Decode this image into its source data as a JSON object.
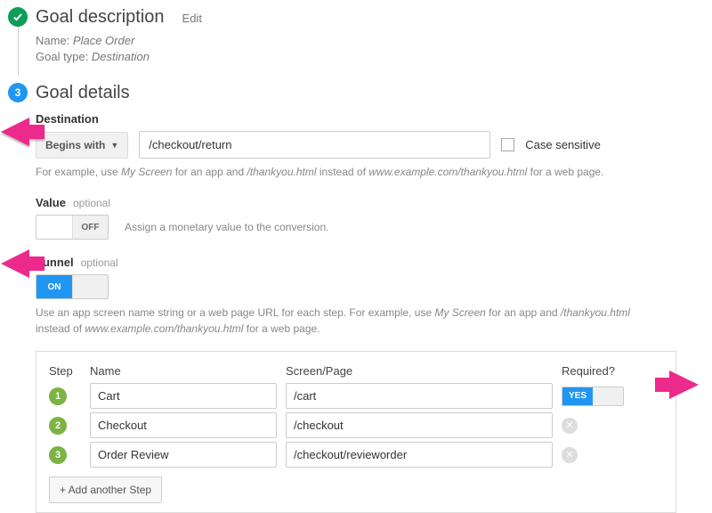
{
  "step1": {
    "title": "Goal description",
    "edit": "Edit",
    "name_label": "Name:",
    "name_value": "Place Order",
    "type_label": "Goal type:",
    "type_value": "Destination"
  },
  "step2": {
    "number": "3",
    "title": "Goal details"
  },
  "destination": {
    "label": "Destination",
    "match": "Begins with",
    "value": "/checkout/return",
    "case_label": "Case sensitive",
    "help_prefix": "For example, use ",
    "help_em1": "My Screen",
    "help_mid": " for an app and ",
    "help_em2": "/thankyou.html",
    "help_mid2": " instead of ",
    "help_em3": "www.example.com/thankyou.html",
    "help_suffix": " for a web page."
  },
  "value": {
    "label": "Value",
    "optional": "optional",
    "toggle_state": "OFF",
    "help": "Assign a monetary value to the conversion."
  },
  "funnel": {
    "label": "Funnel",
    "optional": "optional",
    "toggle_state": "ON",
    "help_1a": "Use an app screen name string or a web page URL for each step. For example, use ",
    "help_em1": "My Screen",
    "help_1b": " for an app and ",
    "help_em2": "/thankyou.html",
    "help_2a": "instead of ",
    "help_em3": "www.example.com/thankyou.html",
    "help_2b": " for a web page.",
    "headers": {
      "step": "Step",
      "name": "Name",
      "page": "Screen/Page",
      "req": "Required?"
    },
    "rows": [
      {
        "num": "1",
        "name": "Cart",
        "page": "/cart",
        "required_toggle": "YES"
      },
      {
        "num": "2",
        "name": "Checkout",
        "page": "/checkout"
      },
      {
        "num": "3",
        "name": "Order Review",
        "page": "/checkout/revieworder"
      }
    ],
    "add_label": "+ Add another Step"
  }
}
